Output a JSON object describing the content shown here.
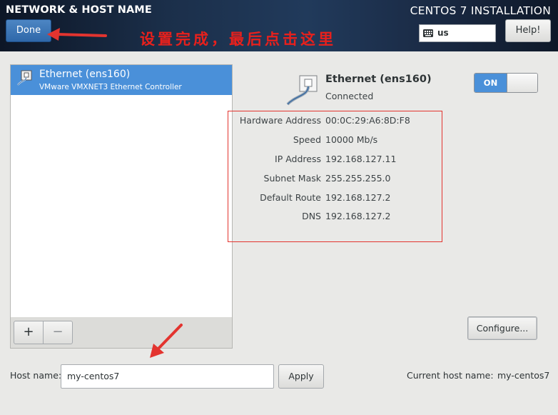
{
  "header": {
    "title": "NETWORK & HOST NAME",
    "done_label": "Done",
    "product_title": "CENTOS 7 INSTALLATION",
    "keyboard_layout": "us",
    "help_label": "Help!",
    "annotation": "设置完成，最后点击这里"
  },
  "connections": [
    {
      "name": "Ethernet (ens160)",
      "description": "VMware VMXNET3 Ethernet Controller"
    }
  ],
  "list_toolbar": {
    "add_label": "+",
    "remove_label": "−"
  },
  "device": {
    "name": "Ethernet (ens160)",
    "status": "Connected",
    "toggle_label": "ON",
    "toggle_on": true
  },
  "details": [
    {
      "label": "Hardware Address",
      "value": "00:0C:29:A6:8D:F8"
    },
    {
      "label": "Speed",
      "value": "10000 Mb/s"
    },
    {
      "label": "IP Address",
      "value": "192.168.127.11"
    },
    {
      "label": "Subnet Mask",
      "value": "255.255.255.0"
    },
    {
      "label": "Default Route",
      "value": "192.168.127.2"
    },
    {
      "label": "DNS",
      "value": "192.168.127.2"
    }
  ],
  "configure_label": "Configure...",
  "hostname": {
    "label": "Host name:",
    "value": "my-centos7",
    "apply_label": "Apply",
    "current_label": "Current host name:",
    "current_value": "my-centos7"
  },
  "colors": {
    "accent": "#4a90d9",
    "annotation_red": "#e3342f",
    "header_dark": "#1b2f4a"
  }
}
